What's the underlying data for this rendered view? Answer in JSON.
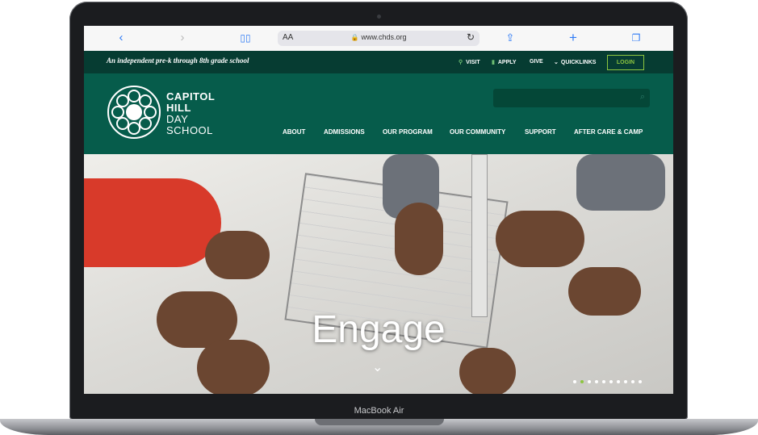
{
  "device": {
    "label": "MacBook Air"
  },
  "browser": {
    "back_icon": "chevron-left-icon",
    "forward_icon": "chevron-right-icon",
    "text_size_label": "AA",
    "url": "www.chds.org"
  },
  "site": {
    "tagline": "An independent pre-k through 8th grade school",
    "utility_links": [
      "VISIT",
      "APPLY",
      "GIVE",
      "QUICKLINKS"
    ],
    "login_label": "LOGIN",
    "logo": {
      "line1": "CAPITOL",
      "line2": "HILL",
      "line3": "DAY",
      "line4": "SCHOOL"
    },
    "search_placeholder": "",
    "nav": [
      "ABOUT",
      "ADMISSIONS",
      "OUR PROGRAM",
      "OUR COMMUNITY",
      "SUPPORT",
      "AFTER CARE & CAMP"
    ],
    "hero": {
      "title": "Engage",
      "slides_total": 10,
      "active_slide": 2
    },
    "colors": {
      "primary": "#065c4b",
      "dark": "#063c32",
      "accent": "#8dc63f"
    }
  }
}
